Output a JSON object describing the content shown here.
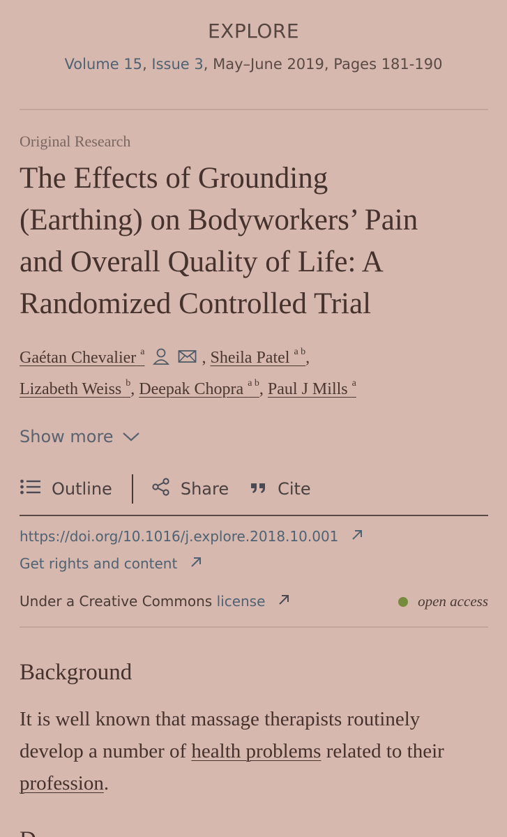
{
  "journal": {
    "name": "EXPLORE",
    "volume": "Volume 15",
    "issue": "Issue 3",
    "rest": ", May–June 2019, Pages 181-190"
  },
  "article": {
    "type": "Original Research",
    "title_lines": [
      "The Effects of Grounding",
      "(Earthing) on Bodyworkers’ Pain",
      "and Overall Quality of Life: A",
      "Randomized Controlled Trial"
    ]
  },
  "authors": [
    {
      "name": "Gaétan Chevalier",
      "aff": "a"
    },
    {
      "name": "Sheila Patel",
      "aff": "a b"
    },
    {
      "name": "Lizabeth Weiss",
      "aff": "b"
    },
    {
      "name": "Deepak Chopra",
      "aff": "a b"
    },
    {
      "name": "Paul J Mills",
      "aff": "a"
    }
  ],
  "show_more": "Show more",
  "actions": {
    "outline": "Outline",
    "share": "Share",
    "cite": "Cite"
  },
  "links": {
    "doi": "https://doi.org/10.1016/j.explore.2018.10.001",
    "rights": "Get rights and content",
    "license_prefix": "Under a Creative Commons ",
    "license_link": "license",
    "open_access": "open access"
  },
  "abstract": {
    "heading": "Background",
    "text_before": "It is well known that massage therapists routinely develop a number of ",
    "kw1": "health problems",
    "text_mid": " related to their ",
    "kw2": "profession",
    "text_after": ".",
    "next_heading": "D"
  },
  "colors": {
    "background": "#d7b8af",
    "link": "#4f6273",
    "open_access_dot": "#768c3c"
  }
}
